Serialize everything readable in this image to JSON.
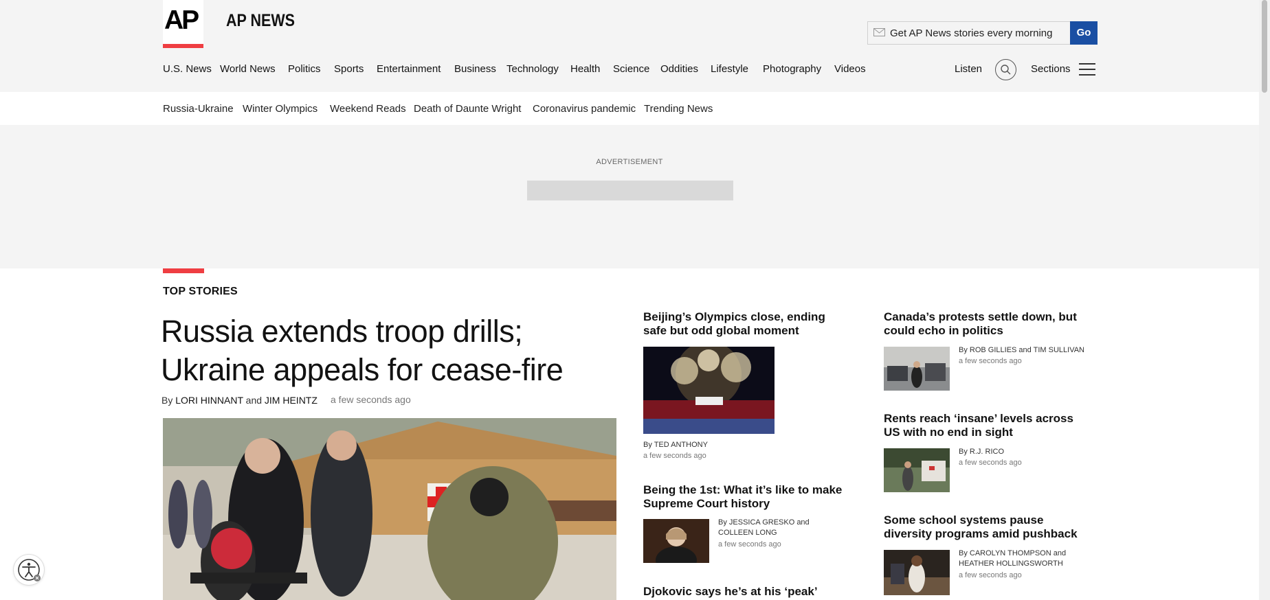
{
  "header": {
    "logo_text": "AP",
    "brand": "AP NEWS",
    "signup_placeholder": "Get AP News stories every morning",
    "go_label": "Go",
    "listen_label": "Listen",
    "sections_label": "Sections"
  },
  "nav": [
    "U.S. News",
    "World News",
    "Politics",
    "Sports",
    "Entertainment",
    "Business",
    "Technology",
    "Health",
    "Science",
    "Oddities",
    "Lifestyle",
    "Photography",
    "Videos"
  ],
  "trending": [
    "Russia-Ukraine",
    "Winter Olympics",
    "Weekend Reads",
    "Death of Daunte Wright",
    "Coronavirus pandemic",
    "Trending News"
  ],
  "ad": {
    "label": "ADVERTISEMENT"
  },
  "top_stories": {
    "section_label": "TOP STORIES",
    "main": {
      "headline": "Russia extends troop drills; Ukraine appeals for cease-fire",
      "by_prefix": "By",
      "author1": "LORI HINNANT",
      "and": "and",
      "author2": "JIM HEINTZ",
      "time": "a few seconds ago"
    },
    "middle": [
      {
        "title": "Beijing’s Olympics close, ending safe but odd global moment",
        "byline": "By TED ANTHONY",
        "time": "a few seconds ago"
      },
      {
        "title": "Being the 1st: What it’s like to make Supreme Court history",
        "byline": "By JESSICA GRESKO and COLLEEN LONG",
        "time": "a few seconds ago"
      },
      {
        "title": "Djokovic says he’s at his ‘peak’",
        "byline": "",
        "time": ""
      }
    ],
    "right": [
      {
        "title": "Canada’s protests settle down, but could echo in politics",
        "byline": "By ROB GILLIES and TIM SULLIVAN",
        "time": "a few seconds ago"
      },
      {
        "title": "Rents reach ‘insane’ levels across US with no end in sight",
        "byline": "By R.J. RICO",
        "time": "a few seconds ago"
      },
      {
        "title": "Some school systems pause diversity programs amid pushback",
        "byline": "By CAROLYN THOMPSON and HEATHER HOLLINGSWORTH",
        "time": "a few seconds ago"
      }
    ]
  },
  "colors": {
    "accent_red": "#ef3e42",
    "go_blue": "#1a4fa3",
    "header_bg": "#f4f4f4"
  }
}
